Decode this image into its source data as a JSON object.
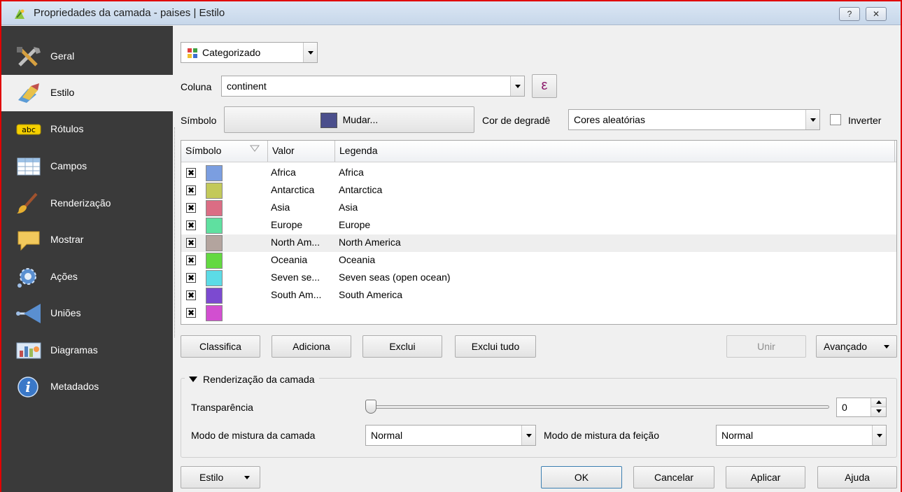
{
  "window": {
    "title": "Propriedades da camada - paises | Estilo",
    "help_button": "?",
    "close_button": "✕"
  },
  "sidebar": {
    "items": [
      {
        "label": "Geral",
        "icon": "tools-icon"
      },
      {
        "label": "Estilo",
        "icon": "paint-icon"
      },
      {
        "label": "Rótulos",
        "icon": "abc-label-icon",
        "badge": "abc"
      },
      {
        "label": "Campos",
        "icon": "table-icon"
      },
      {
        "label": "Renderização",
        "icon": "brush-icon"
      },
      {
        "label": "Mostrar",
        "icon": "speech-bubble-icon"
      },
      {
        "label": "Ações",
        "icon": "gear-icon"
      },
      {
        "label": "Uniões",
        "icon": "join-icon"
      },
      {
        "label": "Diagramas",
        "icon": "diagram-icon"
      },
      {
        "label": "Metadados",
        "icon": "info-icon",
        "badge": "i"
      }
    ]
  },
  "renderer": {
    "type_value": "Categorizado",
    "column_label": "Coluna",
    "column_value": "continent",
    "expression_button": "ε",
    "symbol_label": "Símbolo",
    "change_button": "Mudar...",
    "symbol_color": "#4b4f8c",
    "ramp_label": "Cor de degradê",
    "ramp_value": "Cores aleatórias",
    "invert_label": "Inverter"
  },
  "table": {
    "headers": {
      "symbol": "Símbolo",
      "value": "Valor",
      "legend": "Legenda"
    },
    "rows": [
      {
        "value": "Africa",
        "legend": "Africa",
        "color": "#7b9ee0"
      },
      {
        "value": "Antarctica",
        "legend": "Antarctica",
        "color": "#c3c95a"
      },
      {
        "value": "Asia",
        "legend": "Asia",
        "color": "#db6d84"
      },
      {
        "value": "Europe",
        "legend": "Europe",
        "color": "#5fe0a0"
      },
      {
        "value": "North Am...",
        "legend": "North America",
        "color": "#b3a49e"
      },
      {
        "value": "Oceania",
        "legend": "Oceania",
        "color": "#63d941"
      },
      {
        "value": "Seven se...",
        "legend": "Seven seas (open ocean)",
        "color": "#5cdbe6"
      },
      {
        "value": "South Am...",
        "legend": "South America",
        "color": "#7c4ad0"
      },
      {
        "value": "",
        "legend": "",
        "color": "#d24fd0"
      }
    ]
  },
  "actions": {
    "classify": "Classifica",
    "add": "Adiciona",
    "delete": "Exclui",
    "delete_all": "Exclui tudo",
    "join": "Unir",
    "advanced": "Avançado"
  },
  "layer_rendering": {
    "title": "Renderização da camada",
    "transparency_label": "Transparência",
    "transparency_value": "0",
    "layer_blend_label": "Modo de mistura da camada",
    "layer_blend_value": "Normal",
    "feature_blend_label": "Modo de mistura da feição",
    "feature_blend_value": "Normal"
  },
  "footer": {
    "style": "Estilo",
    "ok": "OK",
    "cancel": "Cancelar",
    "apply": "Aplicar",
    "help": "Ajuda"
  }
}
